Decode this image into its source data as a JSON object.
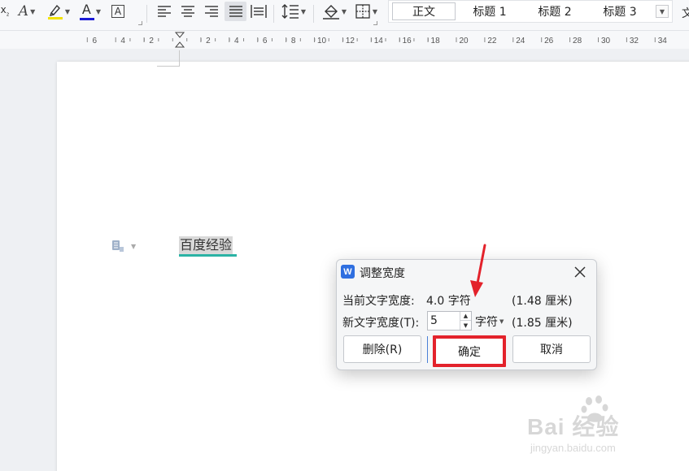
{
  "toolbar": {
    "icons": [
      "subscript-icon",
      "text-effect-icon",
      "highlight-icon",
      "font-color-icon",
      "char-border-icon",
      "align-left-icon",
      "align-center-icon",
      "align-right-icon",
      "justify-icon",
      "distributed-icon",
      "line-spacing-icon",
      "shading-icon",
      "borders-icon"
    ],
    "highlight_color": "#f2e200",
    "font_color": "#1a1ad6",
    "glyph_A": "A",
    "glyph_A_boxed": "A",
    "glyph_sub": "₂"
  },
  "styles": {
    "items": [
      "正文",
      "标题 1",
      "标题 2",
      "标题 3"
    ],
    "selected": "正文",
    "overflow_char": "文"
  },
  "ruler": {
    "labels": [
      "6",
      "4",
      "2",
      "",
      "2",
      "4",
      "6",
      "8",
      "10",
      "12",
      "14",
      "16",
      "18",
      "20",
      "22",
      "24",
      "26",
      "28",
      "30",
      "32",
      "34"
    ]
  },
  "document": {
    "text": "百度经验",
    "underline_color": "#2bb3a5"
  },
  "dialog": {
    "logo_letter": "W",
    "title": "调整宽度",
    "current_label": "当前文字宽度:",
    "current_value": "4.0 字符",
    "current_cm": "(1.48 厘米)",
    "new_label": "新文字宽度(T):",
    "new_value": "5",
    "unit": "字符",
    "new_cm": "(1.85 厘米)",
    "delete_button": "删除(R)",
    "ok_button": "确定",
    "cancel_button": "取消",
    "highlight_color": "#e3222b"
  },
  "watermark": {
    "brand": "Bai  经验",
    "url": "jingyan.baidu.com"
  }
}
